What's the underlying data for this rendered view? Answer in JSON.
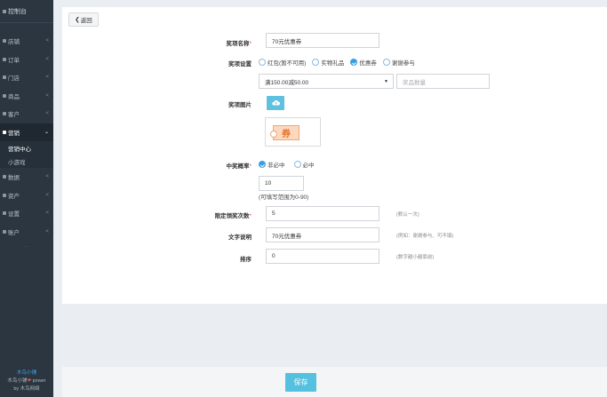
{
  "sidebar": {
    "header": "控制台",
    "items": [
      {
        "label": "店铺",
        "icon": "store-icon"
      },
      {
        "label": "订单",
        "icon": "order-icon"
      },
      {
        "label": "门店",
        "icon": "shop-icon"
      },
      {
        "label": "商品",
        "icon": "goods-icon"
      },
      {
        "label": "客户",
        "icon": "customer-icon"
      },
      {
        "label": "营销",
        "icon": "marketing-icon",
        "active": true
      },
      {
        "label": "数据",
        "icon": "data-icon"
      },
      {
        "label": "资产",
        "icon": "asset-icon"
      },
      {
        "label": "设置",
        "icon": "settings-icon"
      },
      {
        "label": "账户",
        "icon": "account-icon"
      }
    ],
    "sub_items": [
      "营销中心",
      "小游戏"
    ],
    "more": "···",
    "footer": {
      "brand": "木鸟小铺",
      "line2_prefix": "木鸟小铺",
      "line2_suffix": " power",
      "line3": "by 木鸟网络"
    }
  },
  "back_button": {
    "label": "返回"
  },
  "form": {
    "prize_name": {
      "label": "奖项名称",
      "value": "70元优惠券"
    },
    "prize_setting": {
      "label": "奖项设置",
      "options": [
        "红包(暂不可用)",
        "实物礼品",
        "优惠券",
        "谢谢参与"
      ],
      "selected_index": 2,
      "coupon_select": "满150.00减50.00",
      "quantity_placeholder": "奖品数量"
    },
    "prize_image": {
      "label": "奖项图片",
      "coupon_char": "券"
    },
    "win_prob": {
      "label": "中奖概率",
      "options": [
        "非必中",
        "必中"
      ],
      "selected_index": 0,
      "value": "10",
      "hint": "(可填写范围为0-90)"
    },
    "limit": {
      "label": "限定领奖次数",
      "value": "5",
      "hint": "(默认一次)"
    },
    "desc": {
      "label": "文字说明",
      "value": "70元优惠券",
      "hint": "(例如：谢谢参与、可不填)"
    },
    "sort": {
      "label": "排序",
      "value": "0",
      "hint": "(数字越小越靠前)"
    }
  },
  "save_button": {
    "label": "保存"
  },
  "colors": {
    "accent": "#56c0df",
    "radio": "#3a9ee4",
    "sidebar": "#2b3640",
    "required": "#e84c3d"
  }
}
